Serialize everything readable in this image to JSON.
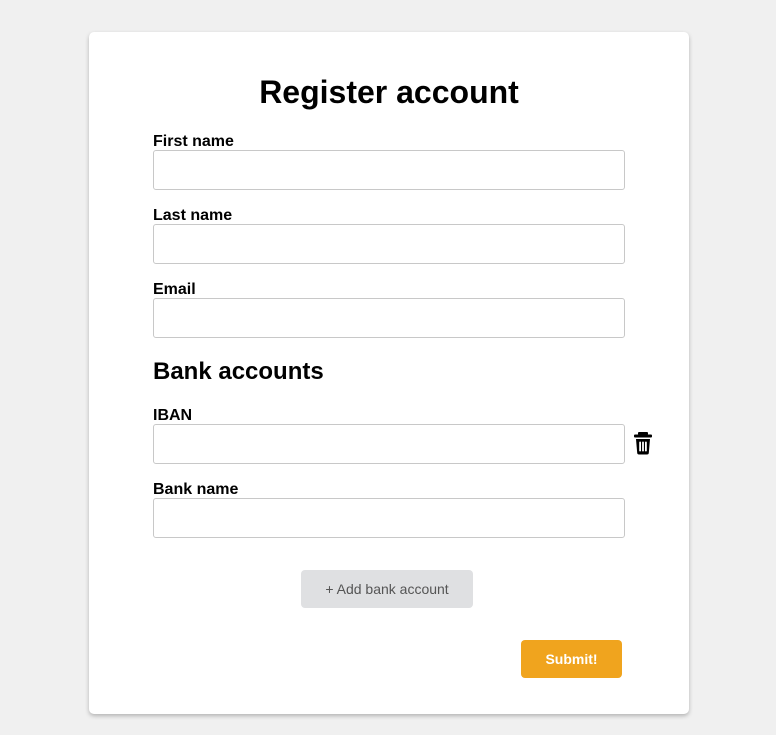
{
  "form": {
    "title": "Register account",
    "first_name": {
      "label": "First name",
      "value": ""
    },
    "last_name": {
      "label": "Last name",
      "value": ""
    },
    "email": {
      "label": "Email",
      "value": ""
    }
  },
  "bank_accounts": {
    "title": "Bank accounts",
    "iban": {
      "label": "IBAN",
      "value": ""
    },
    "bank_name": {
      "label": "Bank name",
      "value": ""
    },
    "delete_icon": "trash-icon",
    "add_label": "+ Add bank account"
  },
  "submit_label": "Submit!",
  "colors": {
    "page_bg": "#f0f0f0",
    "card_bg": "#ffffff",
    "accent": "#f0a41e",
    "secondary_button": "#dfe0e2"
  }
}
